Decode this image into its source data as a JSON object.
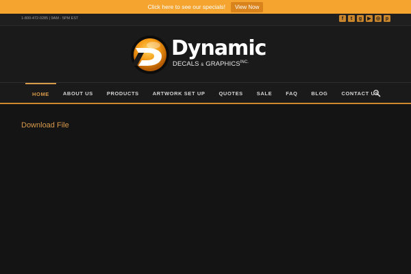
{
  "promo": {
    "text": "Click here to see our specials!",
    "button_label": "View Now"
  },
  "topbar": {
    "phone_hours": "1-800-472-0285 | 9AM - 5PM EST",
    "social_icons": [
      "facebook-icon",
      "twitter-icon",
      "google-plus-icon",
      "youtube-icon",
      "instagram-icon",
      "pinterest-icon"
    ]
  },
  "logo": {
    "wordmark": "Dynamic",
    "sub_decals": "DECALS",
    "sub_amp": "&",
    "sub_graphics": "GRAPHICS",
    "sub_inc": "INC."
  },
  "nav": {
    "items": [
      "HOME",
      "ABOUT US",
      "PRODUCTS",
      "ARTWORK SET UP",
      "QUOTES",
      "SALE",
      "FAQ",
      "BLOG",
      "CONTACT US"
    ],
    "active": "HOME",
    "search_icon": "search-icon"
  },
  "content": {
    "link_text": "Download File"
  },
  "colors": {
    "accent": "#d99a4a",
    "promo_bg": "#f5a42f",
    "background": "#141414"
  }
}
